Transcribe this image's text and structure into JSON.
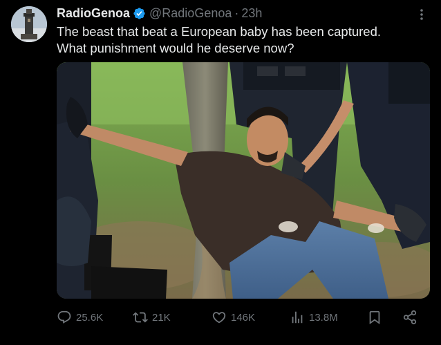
{
  "author": {
    "display_name": "RadioGenoa",
    "handle": "@RadioGenoa",
    "separator": "·",
    "time": "23h",
    "verified_color": "#1d9bf0"
  },
  "tweet": {
    "line1": "The beast that beat a European baby has been captured.",
    "line2": "What punishment would he deserve now?"
  },
  "stats": {
    "replies": "25.6K",
    "reposts": "21K",
    "likes": "146K",
    "views": "13.8M"
  },
  "icons": {
    "reply": "reply-icon",
    "repost": "repost-icon",
    "like": "heart-icon",
    "views": "views-icon",
    "bookmark": "bookmark-icon",
    "share": "share-icon",
    "more": "more-icon"
  },
  "colors": {
    "background": "#000000",
    "text": "#e7e9ea",
    "muted": "#71767b"
  }
}
